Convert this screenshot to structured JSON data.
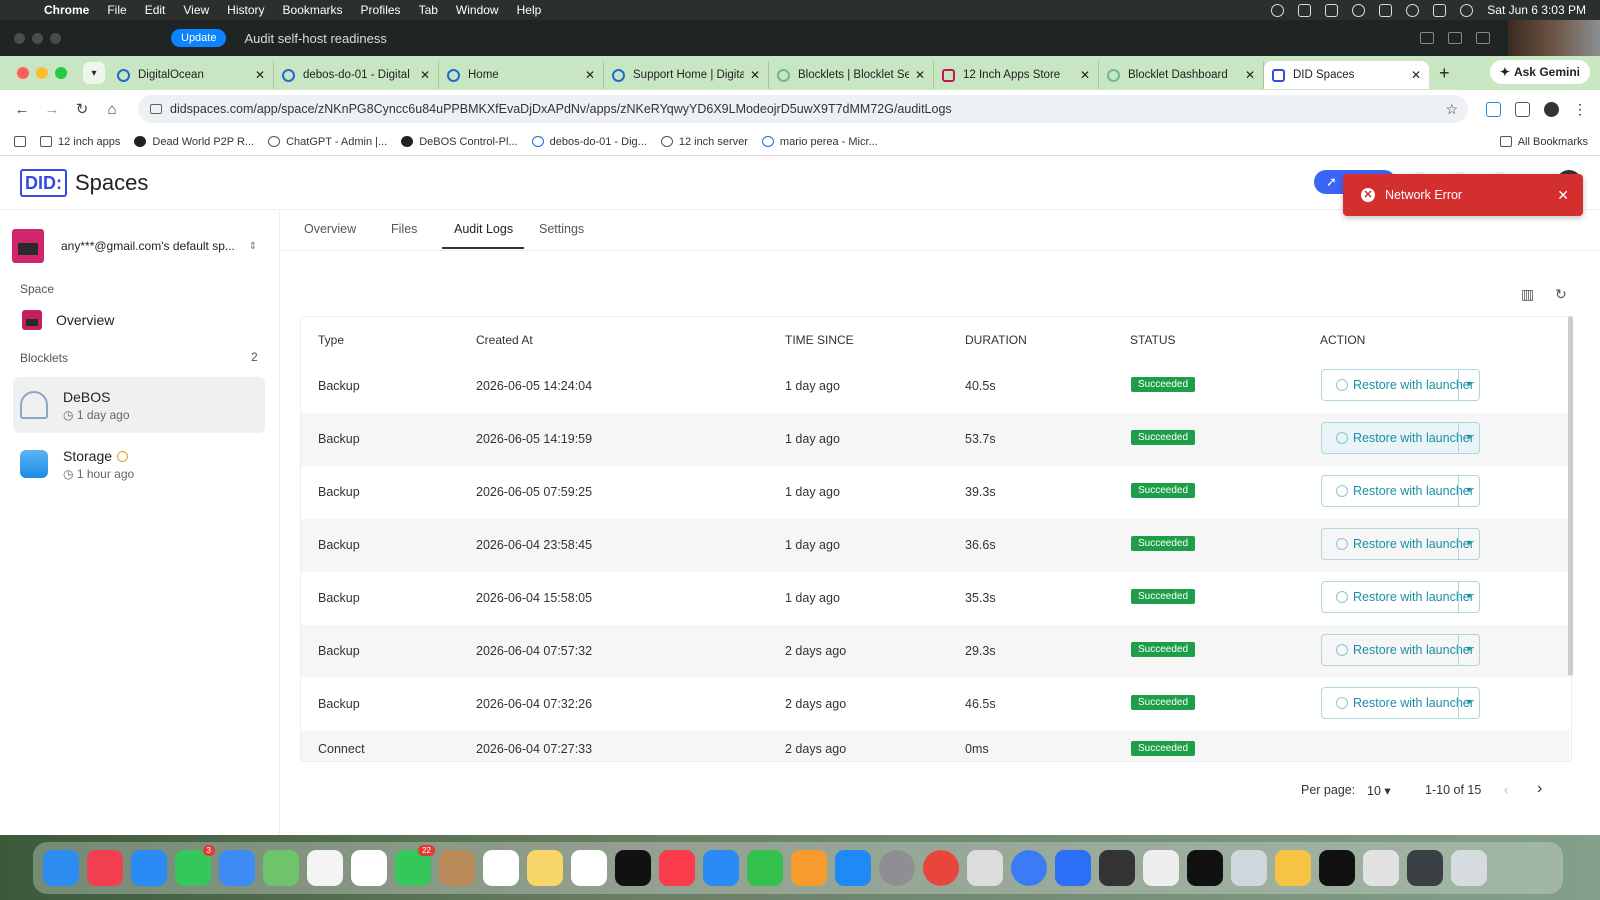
{
  "menubar": {
    "items": [
      "Chrome",
      "File",
      "Edit",
      "View",
      "History",
      "Bookmarks",
      "Profiles",
      "Tab",
      "Window",
      "Help"
    ],
    "datetime": "Sat Jun 6  3:03 PM"
  },
  "topstrip": {
    "update_label": "Update",
    "task_title": "Audit self-host readiness"
  },
  "tabs": [
    {
      "title": "DigitalOcean"
    },
    {
      "title": "debos-do-01 - Digital"
    },
    {
      "title": "Home"
    },
    {
      "title": "Support Home | Digita"
    },
    {
      "title": "Blocklets | Blocklet Se"
    },
    {
      "title": "12 Inch Apps Store"
    },
    {
      "title": "Blocklet Dashboard"
    },
    {
      "title": "DID Spaces"
    }
  ],
  "ask_gemini": "Ask Gemini",
  "url": "didspaces.com/app/space/zNKnPG8Cyncc6u84uPPBMKXfEvaDjDxAPdNv/apps/zNKeRYqwyYD6X9LModeojrD5uwX9T7dMM72G/auditLogs",
  "bookmarks": [
    "12 inch apps",
    "Dead World P2P R...",
    "ChatGPT - Admin |...",
    "DeBOS Control-Pl...",
    "debos-do-01 - Dig...",
    "12 inch server",
    "mario perea - Micr..."
  ],
  "all_bookmarks": "All Bookmarks",
  "app": {
    "logo_mark": "DID:",
    "logo_text": "Spaces",
    "toast": "Network Error",
    "space_name": "any***@gmail.com's default sp...",
    "section_space": "Space",
    "overview": "Overview",
    "section_blocklets": "Blocklets",
    "blocklet_count": "2",
    "blocklets": [
      {
        "name": "DeBOS",
        "status": "1 day ago"
      },
      {
        "name": "Storage",
        "status": "1 hour ago"
      }
    ],
    "main_tabs": [
      "Overview",
      "Files",
      "Audit Logs",
      "Settings"
    ]
  },
  "table": {
    "headers": [
      "Type",
      "Created At",
      "TIME SINCE",
      "DURATION",
      "STATUS",
      "ACTION"
    ],
    "rows": [
      {
        "type": "Backup",
        "created": "2026-06-05 14:24:04",
        "since": "1 day ago",
        "duration": "40.5s",
        "status": "Succeeded",
        "action": "Restore with launcher"
      },
      {
        "type": "Backup",
        "created": "2026-06-05 14:19:59",
        "since": "1 day ago",
        "duration": "53.7s",
        "status": "Succeeded",
        "action": "Restore with launcher"
      },
      {
        "type": "Backup",
        "created": "2026-06-05 07:59:25",
        "since": "1 day ago",
        "duration": "39.3s",
        "status": "Succeeded",
        "action": "Restore with launcher"
      },
      {
        "type": "Backup",
        "created": "2026-06-04 23:58:45",
        "since": "1 day ago",
        "duration": "36.6s",
        "status": "Succeeded",
        "action": "Restore with launcher"
      },
      {
        "type": "Backup",
        "created": "2026-06-04 15:58:05",
        "since": "1 day ago",
        "duration": "35.3s",
        "status": "Succeeded",
        "action": "Restore with launcher"
      },
      {
        "type": "Backup",
        "created": "2026-06-04 07:57:32",
        "since": "2 days ago",
        "duration": "29.3s",
        "status": "Succeeded",
        "action": "Restore with launcher"
      },
      {
        "type": "Backup",
        "created": "2026-06-04 07:32:26",
        "since": "2 days ago",
        "duration": "46.5s",
        "status": "Succeeded",
        "action": "Restore with launcher"
      },
      {
        "type": "Connect",
        "created": "2026-06-04 07:27:33",
        "since": "2 days ago",
        "duration": "0ms",
        "status": "Succeeded",
        "action": ""
      }
    ]
  },
  "pagination": {
    "per_page_label": "Per page:",
    "per_page": "10",
    "range": "1-10 of 15"
  },
  "dock_badges": {
    "messages": "3",
    "facetime": "22"
  },
  "colors": {
    "accent": "#1a8fa6",
    "success": "#1e9e48",
    "error": "#d32f2f",
    "brand": "#334ce5"
  }
}
